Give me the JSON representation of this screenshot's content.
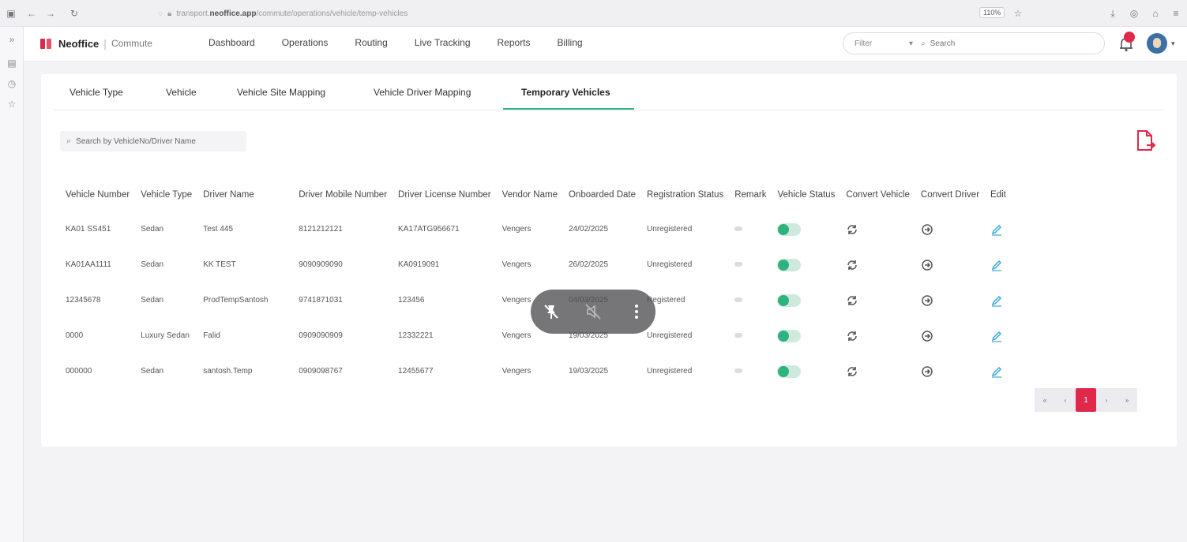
{
  "browser": {
    "url_prefix": "transport.",
    "url_host": "neoffice.app",
    "url_path": "/commute/operations/vehicle/temp-vehicles",
    "zoom": "110%"
  },
  "header": {
    "brand": "Neoffice",
    "separator": "|",
    "product": "Commute",
    "nav": [
      "Dashboard",
      "Operations",
      "Routing",
      "Live Tracking",
      "Reports",
      "Billing"
    ],
    "filter_label": "Filter",
    "search_placeholder": "Search"
  },
  "subtabs": [
    "Vehicle Type",
    "Vehicle",
    "Vehicle Site Mapping",
    "Vehicle Driver Mapping",
    "Temporary Vehicles"
  ],
  "search": {
    "placeholder": "Search by VehicleNo/Driver Name"
  },
  "table": {
    "columns": [
      "Vehicle Number",
      "Vehicle Type",
      "Driver Name",
      "Driver Mobile Number",
      "Driver License Number",
      "Vendor Name",
      "Onboarded Date",
      "Registration Status",
      "Remark",
      "Vehicle Status",
      "Convert Vehicle",
      "Convert Driver",
      "Edit"
    ],
    "rows": [
      [
        "KA01 SS451",
        "Sedan",
        "Test 445",
        "8121212121",
        "KA17ATG956671",
        "Vengers",
        "24/02/2025",
        "Unregistered"
      ],
      [
        "KA01AA1111",
        "Sedan",
        "KK TEST",
        "9090909090",
        "KA0919091",
        "Vengers",
        "26/02/2025",
        "Unregistered"
      ],
      [
        "12345678",
        "Sedan",
        "ProdTempSantosh",
        "9741871031",
        "123456",
        "Vengers",
        "04/03/2025",
        "Registered"
      ],
      [
        "0000",
        "Luxury Sedan",
        "Falid",
        "0909090909",
        "12332221",
        "Vengers",
        "19/03/2025",
        "Unregistered"
      ],
      [
        "000000",
        "Sedan",
        "santosh.Temp",
        "0909098767",
        "12455677",
        "Vengers",
        "19/03/2025",
        "Unregistered"
      ]
    ]
  },
  "pagination": {
    "first": "«",
    "prev": "‹",
    "current": "1",
    "next": "›",
    "last": "»"
  },
  "colors": {
    "accent": "#e0294a",
    "active_tab": "#35b58a",
    "toggle_on": "#2fb37e",
    "edit_icon": "#3aa8d8"
  }
}
